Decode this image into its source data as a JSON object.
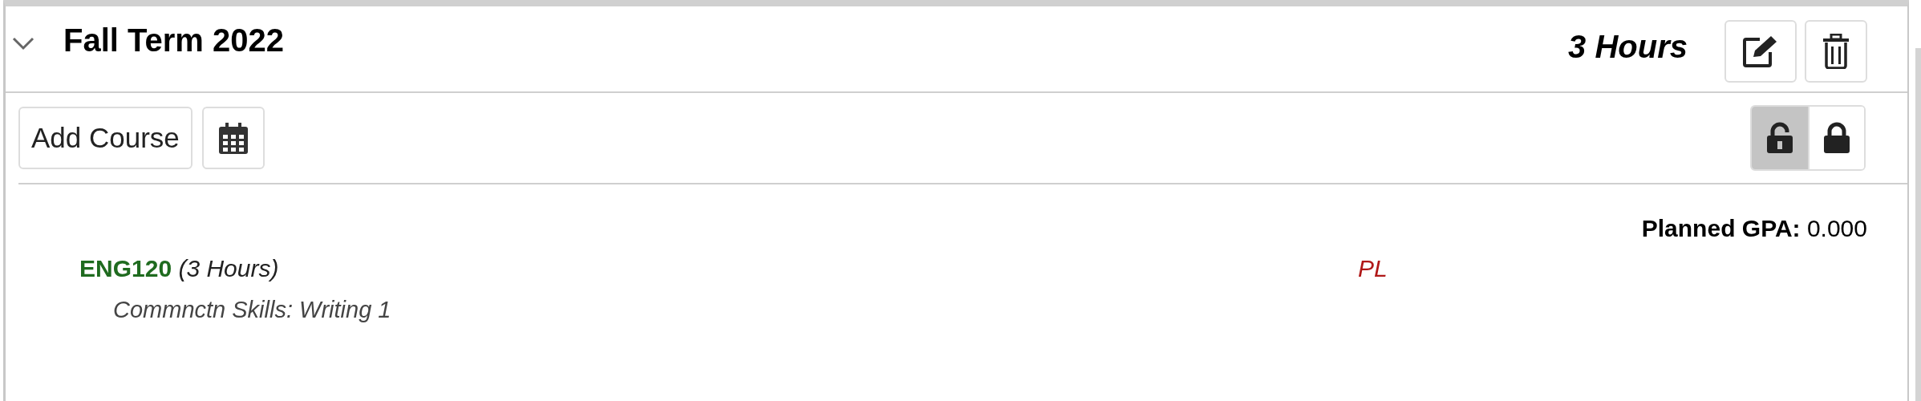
{
  "term": {
    "title": "Fall Term 2022",
    "expanded": true,
    "hours": "3 Hours"
  },
  "toolbar": {
    "add_button": "Add Course",
    "lock_toggle": [
      {
        "kind": "unlocked",
        "selected": true
      },
      {
        "kind": "locked",
        "selected": false
      }
    ]
  },
  "planned_gpa": {
    "label": "Planned GPA:",
    "value": "0.000"
  },
  "courses": [
    {
      "code": "ENG120",
      "hours": "(3 Hours)",
      "title": "Commnctn Skills: Writing 1",
      "status": "PL"
    }
  ]
}
